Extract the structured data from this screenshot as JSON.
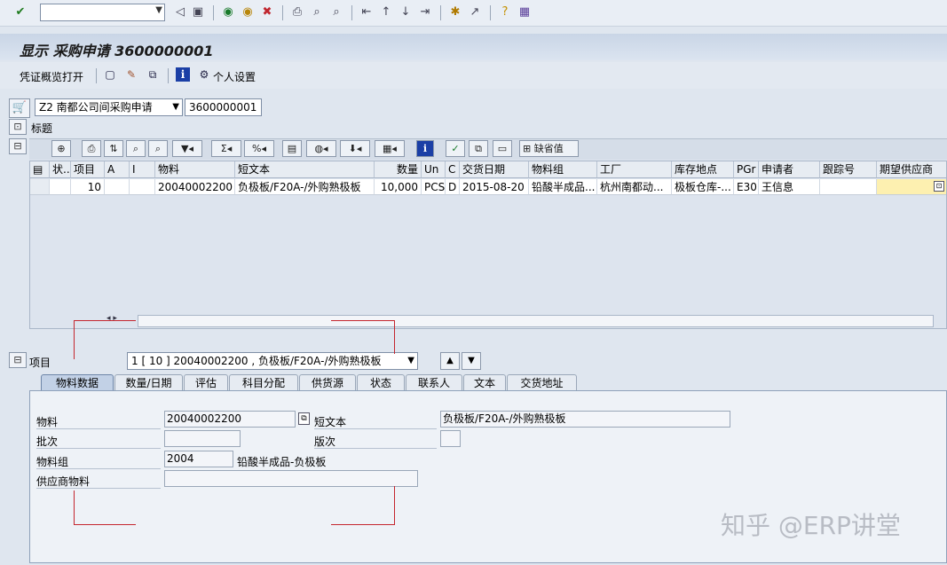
{
  "system_toolbar": {
    "command_field": "",
    "icons": [
      "check-icon",
      "back-icon",
      "save-icon",
      "nav-back-icon",
      "exit-icon",
      "cancel-icon",
      "print-icon",
      "find-icon",
      "find-next-icon",
      "first-page-icon",
      "prev-page-icon",
      "next-page-icon",
      "last-page-icon",
      "new-session-icon",
      "shortcut-icon",
      "help-icon",
      "layout-icon"
    ]
  },
  "title": "显示 采购申请 3600000001",
  "app_toolbar": {
    "doc_overview": "凭证概览打开",
    "personal_settings": "个人设置"
  },
  "document": {
    "type": "Z2 南都公司间采购申请",
    "number": "3600000001"
  },
  "header_label": "标题",
  "alv_toolbar": {
    "default_values": "缺省值"
  },
  "grid": {
    "columns": [
      "状...",
      "项目",
      "A",
      "I",
      "物料",
      "短文本",
      "数量",
      "Un",
      "C",
      "交货日期",
      "物料组",
      "工厂",
      "库存地点",
      "PGr",
      "申请者",
      "跟踪号",
      "期望供应商"
    ],
    "rows": [
      [
        "",
        "10",
        "",
        "",
        "20040002200",
        "负极板/F20A-/外购熟极板",
        "10,000",
        "PCS",
        "D",
        "2015-08-20",
        "铅酸半成品...",
        "杭州南都动...",
        "极板仓库-...",
        "E30",
        "王信息",
        "",
        ""
      ]
    ]
  },
  "item": {
    "label": "项目",
    "selection": "1 [ 10 ] 20040002200 , 负极板/F20A-/外购熟极板"
  },
  "tabs": [
    "物料数据",
    "数量/日期",
    "评估",
    "科目分配",
    "供货源",
    "状态",
    "联系人",
    "文本",
    "交货地址"
  ],
  "material_tab": {
    "material_label": "物料",
    "material_value": "20040002200",
    "short_text_label": "短文本",
    "short_text_value": "负极板/F20A-/外购熟极板",
    "batch_label": "批次",
    "batch_value": "",
    "revision_label": "版次",
    "revision_value": "",
    "material_group_label": "物料组",
    "material_group_value": "2004",
    "material_group_desc": "铅酸半成品-负极板",
    "vendor_material_label": "供应商物料",
    "vendor_material_value": ""
  },
  "watermark": "知乎 @ERP讲堂"
}
